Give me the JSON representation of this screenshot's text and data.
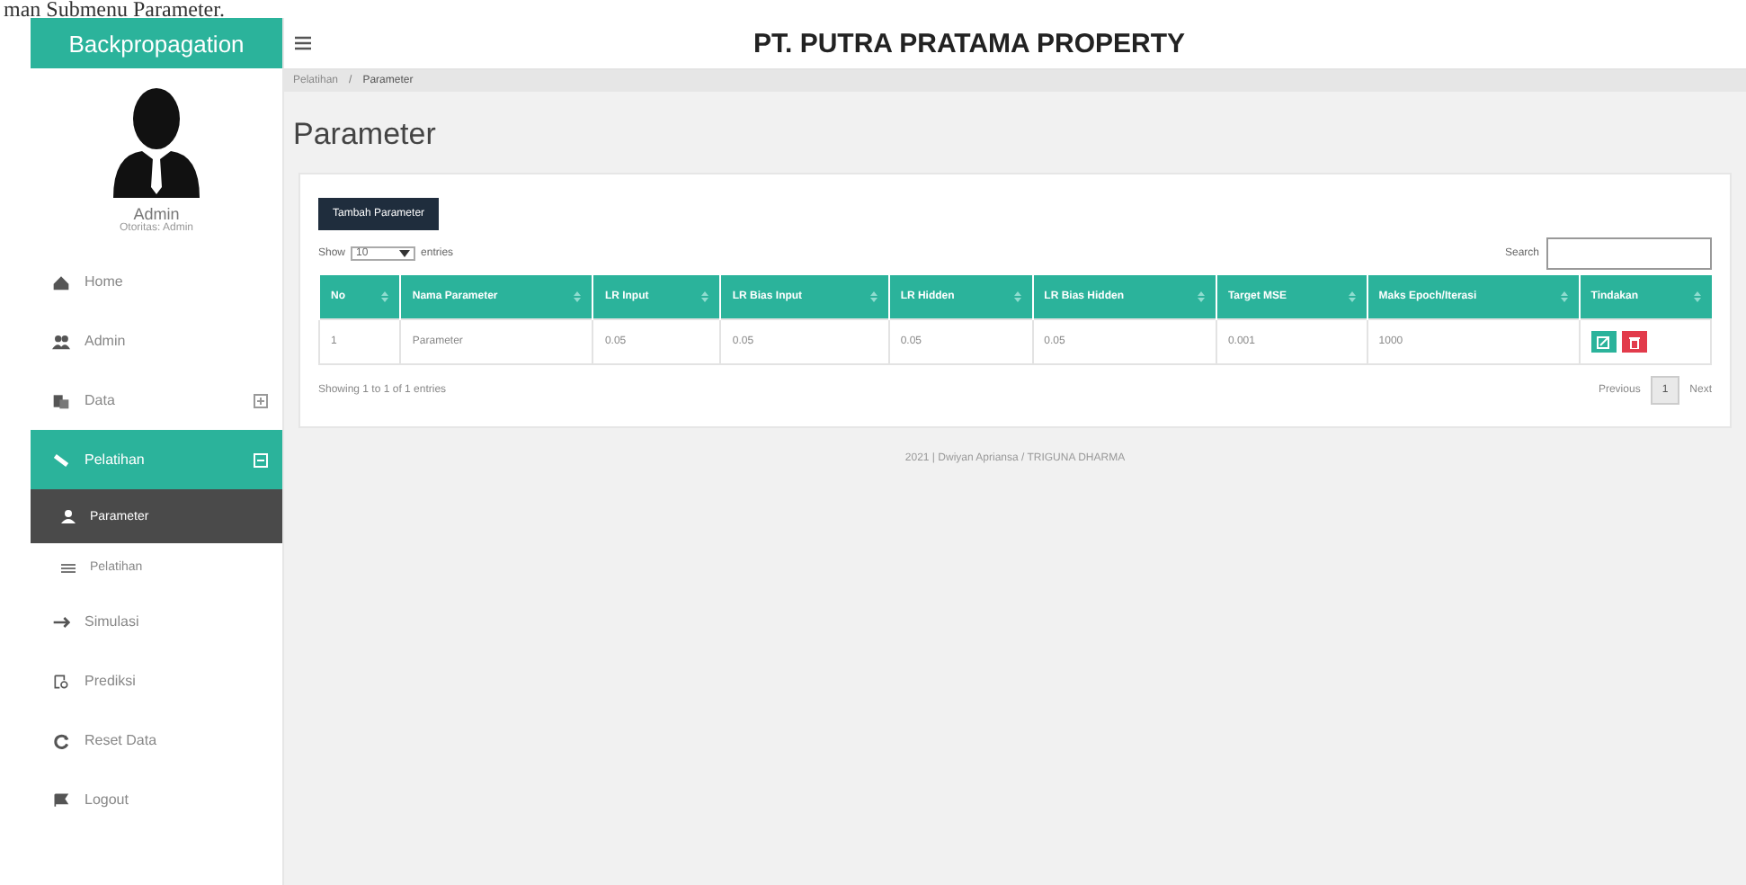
{
  "caption": "man Submenu Parameter.",
  "sidebar": {
    "brand": "Backpropagation",
    "user": {
      "name": "Admin",
      "role": "Otoritas: Admin"
    },
    "items": [
      {
        "label": "Home",
        "selected": false
      },
      {
        "label": "Admin",
        "selected": false
      },
      {
        "label": "Data",
        "selected": false,
        "expanded": false
      },
      {
        "label": "Pelatihan",
        "selected": true,
        "expanded": true,
        "children": [
          {
            "label": "Parameter",
            "selected": true
          },
          {
            "label": "Pelatihan",
            "selected": false
          }
        ]
      },
      {
        "label": "Simulasi",
        "selected": false
      },
      {
        "label": "Prediksi",
        "selected": false
      },
      {
        "label": "Reset Data",
        "selected": false
      },
      {
        "label": "Logout",
        "selected": false
      }
    ]
  },
  "header": {
    "title": "PT. PUTRA PRATAMA PROPERTY"
  },
  "breadcrumb": [
    {
      "kind": "link",
      "label": "Pelatihan"
    },
    {
      "kind": "separator",
      "label": "/"
    },
    {
      "kind": "current",
      "label": "Parameter"
    }
  ],
  "page_title": "Parameter",
  "add_button": "Tambah Parameter",
  "length_control": {
    "before": "Show",
    "value": "10",
    "after": "entries"
  },
  "search": {
    "label": "Search"
  },
  "table": {
    "columns": [
      "No",
      "Nama Parameter",
      "LR Input",
      "LR Bias Input",
      "LR Hidden",
      "LR Bias Hidden",
      "Target MSE",
      "Maks Epoch/Iterasi",
      "Tindakan"
    ],
    "rows": [
      [
        "1",
        "Parameter",
        "0.05",
        "0.05",
        "0.05",
        "0.05",
        "0.001",
        "1000"
      ]
    ]
  },
  "info": "Showing 1 to 1 of 1 entries",
  "pagination": {
    "previous": "Previous",
    "pages": [
      {
        "label": "1",
        "selected": true
      }
    ],
    "next": "Next"
  },
  "footer": "2021 | Dwiyan Apriansa / TRIGUNA DHARMA"
}
